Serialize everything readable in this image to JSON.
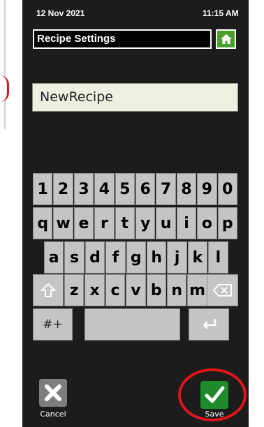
{
  "status": {
    "date": "12 Nov 2021",
    "time": "11:15 AM"
  },
  "header": {
    "title": "Recipe Settings",
    "home_icon": "home-icon"
  },
  "recipe_name": {
    "value": "NewRecipe"
  },
  "keyboard": {
    "row1": [
      "1",
      "2",
      "3",
      "4",
      "5",
      "6",
      "7",
      "8",
      "9",
      "0"
    ],
    "row2": [
      "q",
      "w",
      "e",
      "r",
      "t",
      "y",
      "u",
      "i",
      "o",
      "p"
    ],
    "row3": [
      "a",
      "s",
      "d",
      "f",
      "g",
      "h",
      "j",
      "k",
      "l"
    ],
    "row4": [
      "z",
      "x",
      "c",
      "v",
      "b",
      "n",
      "m"
    ],
    "symbols_label": "#+",
    "shift_icon": "shift-icon",
    "backspace_icon": "backspace-icon",
    "enter_icon": "enter-icon"
  },
  "actions": {
    "cancel_label": "Cancel",
    "save_label": "Save"
  },
  "colors": {
    "home": "#4aa02c",
    "save": "#1e8a2c",
    "highlight": "#e0141a"
  }
}
